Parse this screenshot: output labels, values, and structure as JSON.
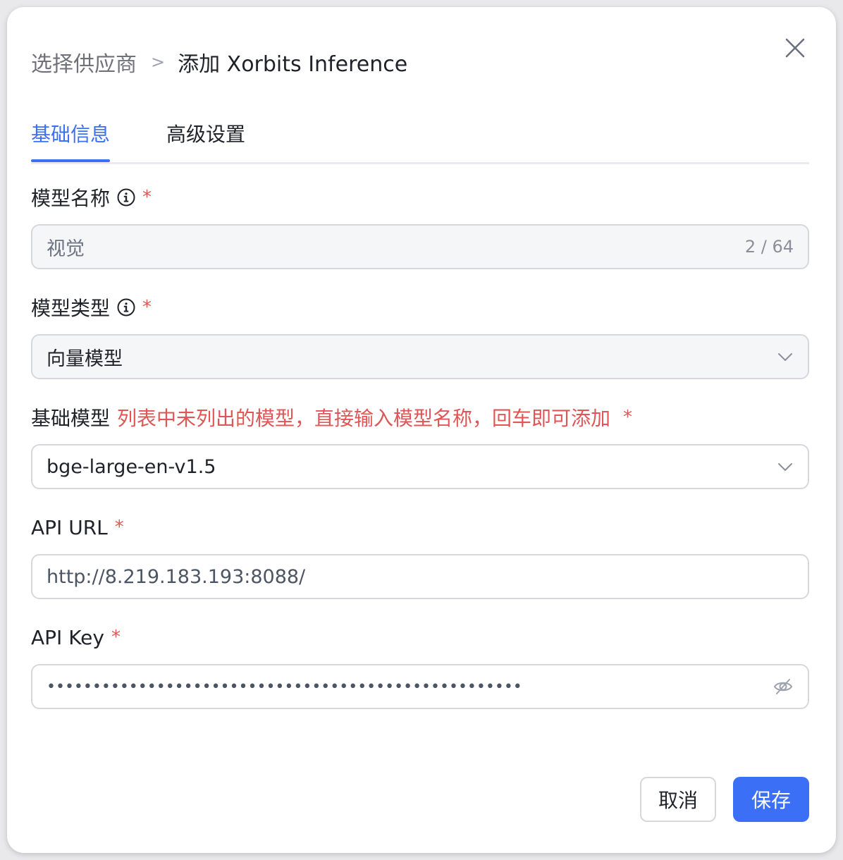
{
  "header": {
    "breadcrumb_prev": "选择供应商",
    "breadcrumb_sep": ">",
    "title": "添加 Xorbits Inference"
  },
  "tabs": [
    {
      "label": "基础信息",
      "active": true
    },
    {
      "label": "高级设置",
      "active": false
    }
  ],
  "form": {
    "model_name": {
      "label": "模型名称",
      "required_mark": "*",
      "value": "视觉",
      "counter": "2 / 64"
    },
    "model_type": {
      "label": "模型类型",
      "required_mark": "*",
      "value": "向量模型"
    },
    "base_model": {
      "label": "基础模型",
      "hint": "列表中未列出的模型，直接输入模型名称，回车即可添加",
      "required_mark": "*",
      "value": "bge-large-en-v1.5"
    },
    "api_url": {
      "label": "API URL",
      "required_mark": "*",
      "value": "http://8.219.183.193:8088/"
    },
    "api_key": {
      "label": "API Key",
      "required_mark": "*",
      "masked_value": "••••••••••••••••••••••••••••••••••••••••••••••••••••"
    }
  },
  "footer": {
    "cancel_label": "取消",
    "save_label": "保存"
  },
  "colors": {
    "accent": "#3b6ff5",
    "required": "#e05656"
  }
}
